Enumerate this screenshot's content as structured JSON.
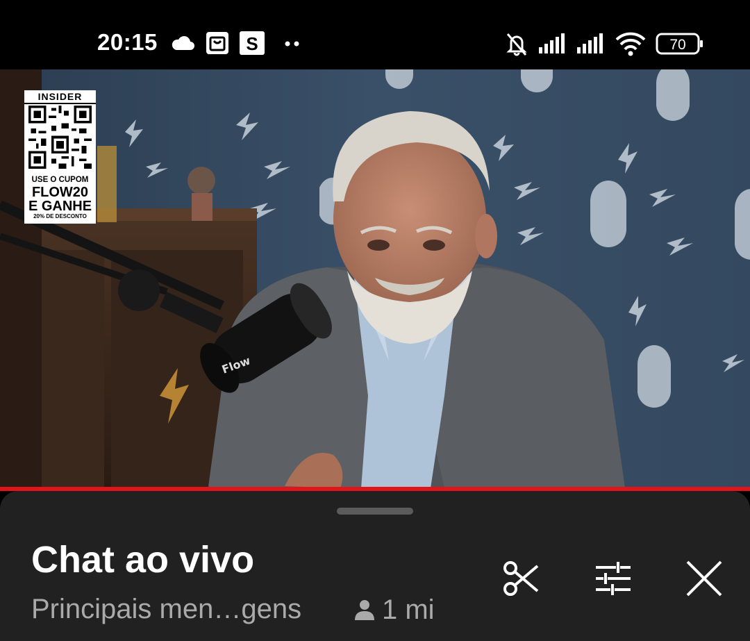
{
  "status_bar": {
    "time": "20:15",
    "battery": "70",
    "icons": [
      "cloud-icon",
      "shopping-bag-icon",
      "s-app-icon",
      "more-dots-icon",
      "muted-bell-icon",
      "signal-icon",
      "signal-icon",
      "wifi-icon",
      "battery-icon"
    ]
  },
  "video": {
    "sponsor_badge": {
      "brand": "INSIDER",
      "line1": "USE O CUPOM",
      "line2": "FLOW20",
      "line3": "E GANHE",
      "line4": "20% DE DESCONTO"
    },
    "mic_logo": "Flow",
    "progress": 1.0,
    "progress_color": "#e0141b"
  },
  "chat_panel": {
    "title": "Chat ao vivo",
    "mode_label": "Principais men…gens",
    "viewer_count": "1 mi",
    "icons": [
      "scissors-icon",
      "filter-sliders-icon",
      "close-icon"
    ]
  }
}
